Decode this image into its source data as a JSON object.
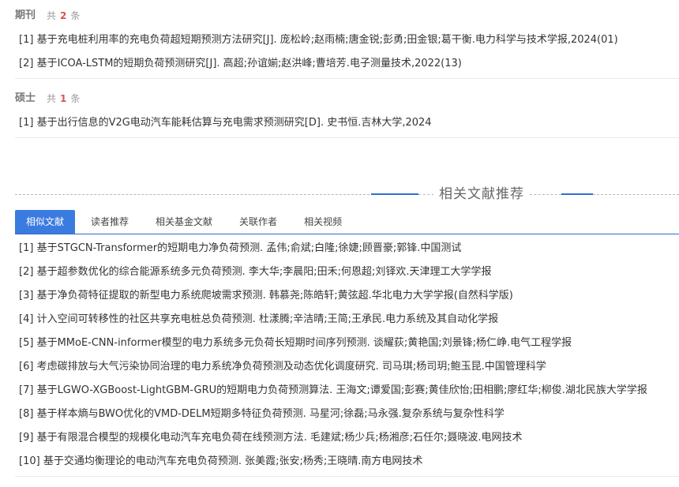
{
  "journal": {
    "title": "期刊",
    "count_prefix": "共",
    "count": "2",
    "count_suffix": "条",
    "items": [
      {
        "index": "[1]",
        "text": "基于充电桩利用率的充电负荷超短期预测方法研究[J]. 庞松岭;赵雨楠;唐金锐;彭勇;田金银;葛干衡.电力科学与技术学报,2024(01)"
      },
      {
        "index": "[2]",
        "text": "基于ICOA-LSTM的短期负荷预测研究[J]. 高超;孙谊媊;赵洪峰;曹培芳.电子测量技术,2022(13)"
      }
    ]
  },
  "master": {
    "title": "硕士",
    "count_prefix": "共",
    "count": "1",
    "count_suffix": "条",
    "items": [
      {
        "index": "[1]",
        "text": "基于出行信息的V2G电动汽车能耗估算与充电需求预测研究[D]. 史书恒.吉林大学,2024"
      }
    ]
  },
  "recommend": {
    "title": "相关文献推荐",
    "tabs": [
      "相似文献",
      "读者推荐",
      "相关基金文献",
      "关联作者",
      "相关视频"
    ],
    "active_tab": "相似文献",
    "items": [
      {
        "index": "[1]",
        "text": "基于STGCN-Transformer的短期电力净负荷预测. 孟伟;俞斌;白隆;徐婕;顾晋豪;郭锋.中国测试"
      },
      {
        "index": "[2]",
        "text": "基于超参数优化的综合能源系统多元负荷预测. 李大华;李晨阳;田禾;何恩超;刘铎欢.天津理工大学学报"
      },
      {
        "index": "[3]",
        "text": "基于净负荷特征提取的新型电力系统爬坡需求预测. 韩慕尧;陈皓轩;黄弦超.华北电力大学学报(自然科学版)"
      },
      {
        "index": "[4]",
        "text": "计入空间可转移性的社区共享充电桩总负荷预测. 杜漾腾;辛洁晴;王简;王承民.电力系统及其自动化学报"
      },
      {
        "index": "[5]",
        "text": "基于MMoE-CNN-informer模型的电力系统多元负荷长短期时间序列预测. 谈耀荻;黄艳国;刘景锋;杨仁峥.电气工程学报"
      },
      {
        "index": "[6]",
        "text": "考虑碳排放与大气污染协同治理的电力系统净负荷预测及动态优化调度研究. 司马琪;杨司玥;鲍玉昆.中国管理科学"
      },
      {
        "index": "[7]",
        "text": "基于LGWO-XGBoost-LightGBM-GRU的短期电力负荷预测算法. 王海文;谭爱国;彭赛;黄佳欣怡;田相鹏;廖红华;柳俊.湖北民族大学学报"
      },
      {
        "index": "[8]",
        "text": "基于样本熵与BWO优化的VMD-DELM短期多特征负荷预测. 马星河;徐磊;马永强.复杂系统与复杂性科学"
      },
      {
        "index": "[9]",
        "text": "基于有限混合模型的规模化电动汽车充电负荷在线预测方法. 毛建斌;杨少兵;杨湘彦;石任尔;聂晓波.电网技术"
      },
      {
        "index": "[10]",
        "text": "基于交通均衡理论的电动汽车充电负荷预测. 张美霞;张安;杨秀;王晓晴.南方电网技术"
      }
    ]
  },
  "colors": {
    "accent": "#3a7be0",
    "count_red": "#d9534f"
  }
}
